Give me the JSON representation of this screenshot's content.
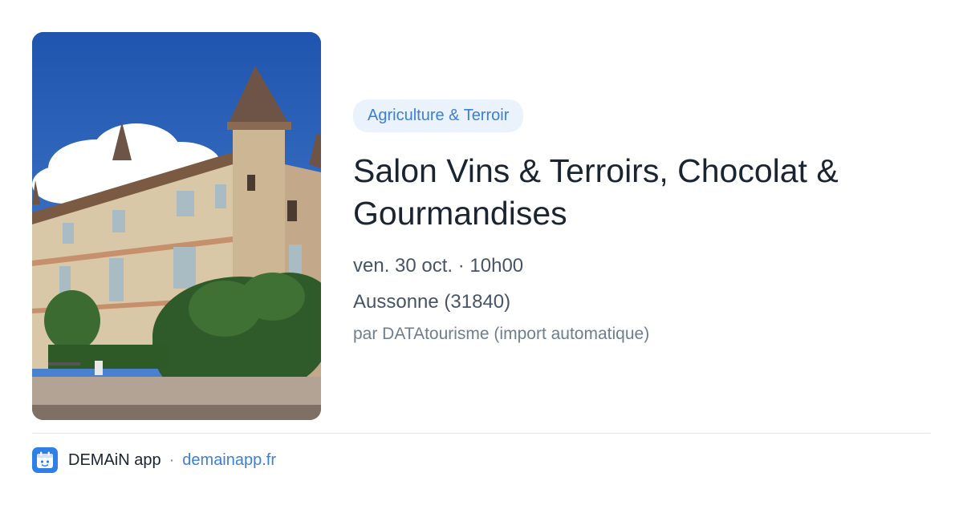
{
  "event": {
    "category": "Agriculture & Terroir",
    "title": "Salon Vins & Terroirs, Chocolat & Gourmandises",
    "date_time": "ven. 30 oct. · 10h00",
    "location": "Aussonne (31840)",
    "source": "par DATAtourisme (import automatique)"
  },
  "footer": {
    "app_name": "DEMAiN app",
    "separator": "·",
    "link": "demainapp.fr"
  },
  "colors": {
    "accent": "#3b7fd9",
    "badge_bg": "#eaf2fc",
    "title": "#1b2431",
    "meta": "#475465",
    "divider": "#e2e6ea"
  },
  "icons": {
    "app": "demain-app-icon"
  }
}
